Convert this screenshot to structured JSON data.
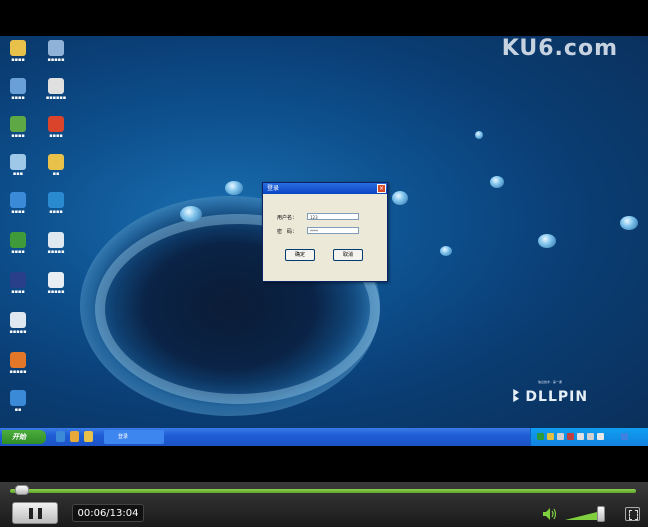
{
  "player": {
    "watermark": "KU6.com",
    "current_time": "00:06",
    "total_time": "13:04",
    "time_display": "00:06/13:04",
    "progress_fraction": 0.008,
    "volume_fraction": 0.8,
    "accent_color": "#7fcf3f"
  },
  "desktop": {
    "taskbar": {
      "start_label": "开始",
      "task_label": "登录"
    },
    "dialog": {
      "title": "登录",
      "user_label": "用户名：",
      "user_value": "123",
      "password_label": "密　码：",
      "password_value": "****",
      "ok_label": "确定",
      "cancel_label": "取消"
    },
    "logo": {
      "name": "DLLPIN",
      "tagline": "信息技术 · 第一课"
    },
    "icons": [
      {
        "name": "folder-icon",
        "color": "#e8c14a"
      },
      {
        "name": "computer-icon",
        "color": "#8fb3d8"
      },
      {
        "name": "network-icon",
        "color": "#6aa0d8"
      },
      {
        "name": "recycle-bin-icon",
        "color": "#9ec7e8"
      },
      {
        "name": "ie-icon",
        "color": "#3a8ad8"
      },
      {
        "name": "app-icon",
        "color": "#5ea845"
      },
      {
        "name": "media-icon",
        "color": "#2a3f8a"
      },
      {
        "name": "document-icon",
        "color": "#e0e0e0"
      },
      {
        "name": "app-icon",
        "color": "#e2772a"
      },
      {
        "name": "ie-icon",
        "color": "#3a8ad8"
      },
      {
        "name": "document-icon",
        "color": "#dfe8f0"
      },
      {
        "name": "document-icon",
        "color": "#dfe8f0"
      },
      {
        "name": "pdf-icon",
        "color": "#d9442a"
      },
      {
        "name": "folder-icon",
        "color": "#e8c14a"
      },
      {
        "name": "app-icon",
        "color": "#2a8ad0"
      },
      {
        "name": "document-icon",
        "color": "#e8eef4"
      },
      {
        "name": "document-icon",
        "color": "#e8eef4"
      }
    ]
  }
}
